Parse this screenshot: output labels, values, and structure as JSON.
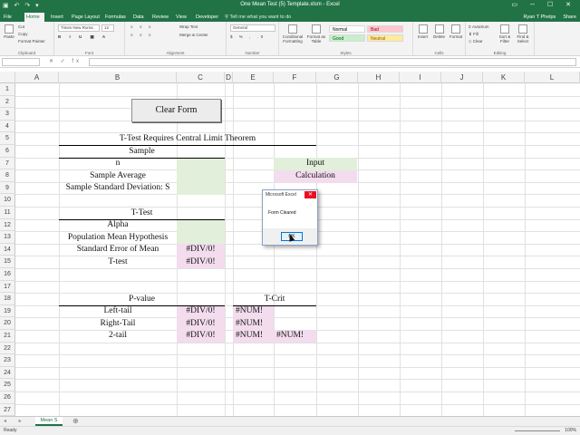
{
  "window": {
    "title": "One Mean Test (5) Template.xlsm - Excel",
    "user": "Ryan T Phelps",
    "share": "Share"
  },
  "ribbon": {
    "tabs": [
      "File",
      "Home",
      "Insert",
      "Page Layout",
      "Formulas",
      "Data",
      "Review",
      "View",
      "Developer"
    ],
    "active_tab": "Home",
    "tell_me": "Tell me what you want to do",
    "clipboard": {
      "paste": "Paste",
      "cut": "Cut",
      "copy": "Copy",
      "format_painter": "Format Painter",
      "label": "Clipboard"
    },
    "font": {
      "name": "Times New Roma",
      "size": "12",
      "label": "Font"
    },
    "alignment": {
      "wrap": "Wrap Text",
      "merge": "Merge & Center",
      "label": "Alignment"
    },
    "number": {
      "format": "General",
      "label": "Number"
    },
    "styles": {
      "conditional": "Conditional Formatting",
      "format_table": "Format as Table",
      "normal": "Normal",
      "bad": "Bad",
      "good": "Good",
      "neutral": "Neutral",
      "label": "Styles"
    },
    "cells": {
      "insert": "Insert",
      "delete": "Delete",
      "format": "Format",
      "label": "Cells"
    },
    "editing": {
      "autosum": "AutoSum",
      "fill": "Fill",
      "clear": "Clear",
      "sort": "Sort & Filter",
      "find": "Find & Select",
      "label": "Editing"
    }
  },
  "formula_bar": {
    "name_box": "",
    "formula": ""
  },
  "columns": [
    "A",
    "B",
    "C",
    "D",
    "E",
    "F",
    "G",
    "H",
    "I",
    "J",
    "K",
    "L"
  ],
  "rows": [
    "1",
    "2",
    "3",
    "4",
    "5",
    "6",
    "7",
    "8",
    "9",
    "10",
    "11",
    "12",
    "13",
    "14",
    "15",
    "16",
    "17",
    "18",
    "19",
    "20",
    "21",
    "22",
    "23",
    "24",
    "25",
    "26",
    "27"
  ],
  "sheet": {
    "clear_button": "Clear Form",
    "header": "T-Test Requires Central Limit Theorem",
    "sample_title": "Sample",
    "n_label": "n",
    "avg_label": "Sample Average",
    "sd_label": "Sample Standard Deviation: S",
    "ttest_title": "T-Test",
    "alpha_label": "Alpha",
    "pop_label": "Population Mean Hypothesis",
    "se_label": "Standard Error of Mean",
    "se_value": "#DIV/0!",
    "t_label": "T-test",
    "t_value": "#DIV/0!",
    "pvalue_title": "P-value",
    "left_label": "Left-tail",
    "left_value": "#DIV/0!",
    "right_label": "Right-Tail",
    "right_value": "#DIV/0!",
    "two_label": "2-tail",
    "two_value": "#DIV/0!",
    "tcrit_title": "T-Crit",
    "tcrit_left": "#NUM!",
    "tcrit_right": "#NUM!",
    "tcrit_two_a": "#NUM!",
    "tcrit_two_b": "#NUM!",
    "legend_input": "Input",
    "legend_calc": "Calculation"
  },
  "sheet_tab": "Mean S",
  "status": {
    "mode": "Ready",
    "zoom": "100%"
  },
  "dialog": {
    "title": "Microsoft Excel",
    "message": "Form Cleared",
    "ok": "OK"
  },
  "colors": {
    "input": "#e2efda",
    "calculation": "#f3dcee",
    "excel_green": "#217346"
  }
}
